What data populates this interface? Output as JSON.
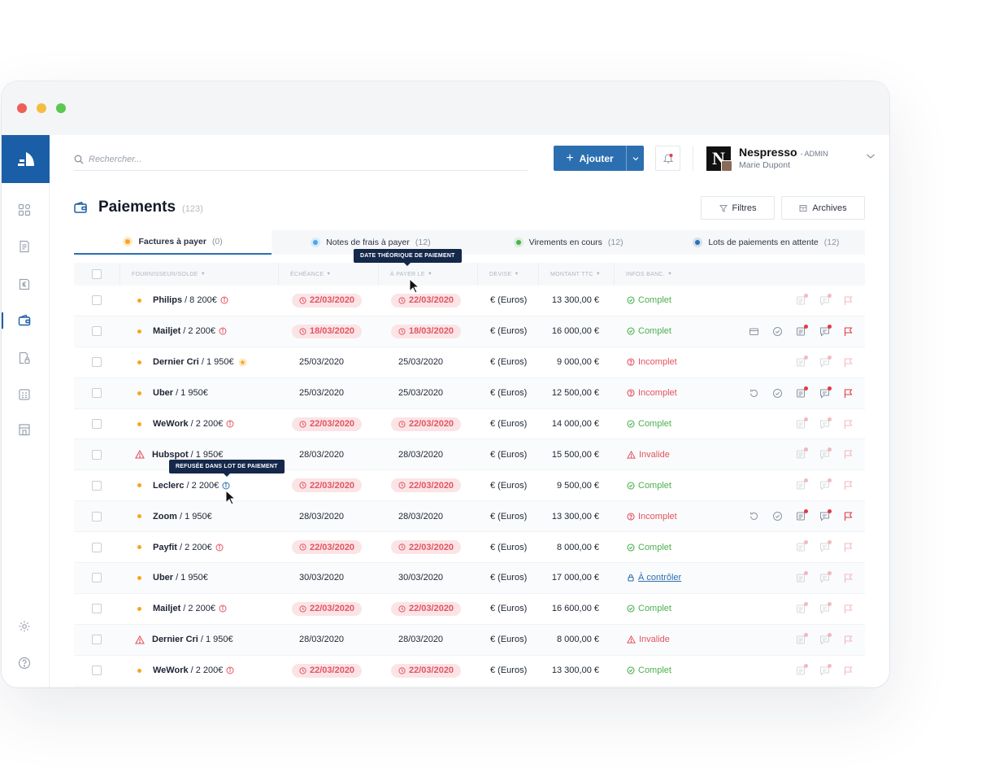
{
  "search": {
    "placeholder": "Rechercher..."
  },
  "header": {
    "add_label": "Ajouter",
    "company": "Nespresso",
    "company_logo_letter": "N",
    "role": "- ADMIN",
    "user": "Marie Dupont"
  },
  "page": {
    "title": "Paiements",
    "count": "(123)",
    "filters_label": "Filtres",
    "archives_label": "Archives"
  },
  "tabs": [
    {
      "label": "Factures à payer",
      "count": "(0)",
      "color": "#f5a623"
    },
    {
      "label": "Notes de frais à payer",
      "count": "(12)",
      "color": "#4aa8e8"
    },
    {
      "label": "Virements en cours",
      "count": "(12)",
      "color": "#4caf50"
    },
    {
      "label": "Lots de paiements en attente",
      "count": "(12)",
      "color": "#2c6fb1"
    }
  ],
  "columns": {
    "supplier": "FOURNISSEUR/SOLDE",
    "due": "ÉCHÉANCE",
    "pay_on": "À PAYER LE",
    "currency": "DEVISE",
    "amount": "MONTANT TTC",
    "bank": "INFOS BANC."
  },
  "tooltips": {
    "pay_date": "DATE THÉORIQUE DE PAIEMENT",
    "refused": "REFUSÉE DANS LOT DE PAIEMENT"
  },
  "rows": [
    {
      "name": "Philips",
      "balance": "/ 8 200€",
      "due": "22/03/2020",
      "pay": "22/03/2020",
      "currency": "€ (Euros)",
      "amount": "13 300,00 €",
      "status": "Complet"
    },
    {
      "name": "Mailjet",
      "balance": "/ 2 200€",
      "due": "18/03/2020",
      "pay": "18/03/2020",
      "currency": "€ (Euros)",
      "amount": "16 000,00 €",
      "status": "Complet"
    },
    {
      "name": "Dernier Cri",
      "balance": "/ 1 950€",
      "due": "25/03/2020",
      "pay": "25/03/2020",
      "currency": "€ (Euros)",
      "amount": "9 000,00 €",
      "status": "Incomplet"
    },
    {
      "name": "Uber",
      "balance": "/ 1 950€",
      "due": "25/03/2020",
      "pay": "25/03/2020",
      "currency": "€ (Euros)",
      "amount": "12 500,00 €",
      "status": "Incomplet"
    },
    {
      "name": "WeWork",
      "balance": "/ 2 200€",
      "due": "22/03/2020",
      "pay": "22/03/2020",
      "currency": "€ (Euros)",
      "amount": "14 000,00 €",
      "status": "Complet"
    },
    {
      "name": "Hubspot",
      "balance": "/ 1 950€",
      "due": "28/03/2020",
      "pay": "28/03/2020",
      "currency": "€ (Euros)",
      "amount": "15 500,00 €",
      "status": "Invalide"
    },
    {
      "name": "Leclerc",
      "balance": "/ 2 200€",
      "due": "22/03/2020",
      "pay": "22/03/2020",
      "currency": "€ (Euros)",
      "amount": "9 500,00 €",
      "status": "Complet"
    },
    {
      "name": "Zoom",
      "balance": "/ 1 950€",
      "due": "28/03/2020",
      "pay": "28/03/2020",
      "currency": "€ (Euros)",
      "amount": "13 300,00 €",
      "status": "Incomplet"
    },
    {
      "name": "Payfit",
      "balance": "/ 2 200€",
      "due": "22/03/2020",
      "pay": "22/03/2020",
      "currency": "€ (Euros)",
      "amount": "8 000,00 €",
      "status": "Complet"
    },
    {
      "name": "Uber",
      "balance": "/ 1 950€",
      "due": "30/03/2020",
      "pay": "30/03/2020",
      "currency": "€ (Euros)",
      "amount": "17 000,00 €",
      "status": "À contrôler"
    },
    {
      "name": "Mailjet",
      "balance": "/ 2 200€",
      "due": "22/03/2020",
      "pay": "22/03/2020",
      "currency": "€ (Euros)",
      "amount": "16 600,00 €",
      "status": "Complet"
    },
    {
      "name": "Dernier Cri",
      "balance": "/ 1 950€",
      "due": "28/03/2020",
      "pay": "28/03/2020",
      "currency": "€ (Euros)",
      "amount": "8 000,00 €",
      "status": "Invalide"
    },
    {
      "name": "WeWork",
      "balance": "/ 2 200€",
      "due": "22/03/2020",
      "pay": "22/03/2020",
      "currency": "€ (Euros)",
      "amount": "13 300,00 €",
      "status": "Complet"
    }
  ],
  "row_flags": [
    {
      "overdue": true,
      "marker": "dot",
      "note": "info-icon",
      "actions": "faint"
    },
    {
      "overdue": true,
      "marker": "dot",
      "note": "info-icon",
      "actions": "full"
    },
    {
      "overdue": false,
      "marker": "dot",
      "note": "star-icon",
      "actions": "faint"
    },
    {
      "overdue": false,
      "marker": "dot",
      "note": "",
      "actions": "full-refresh"
    },
    {
      "overdue": true,
      "marker": "dot",
      "note": "info-icon",
      "actions": "faint"
    },
    {
      "overdue": false,
      "marker": "warning",
      "note": "",
      "actions": "faint"
    },
    {
      "overdue": true,
      "marker": "dot",
      "note": "info-blue-icon",
      "actions": "faint"
    },
    {
      "overdue": false,
      "marker": "dot",
      "note": "",
      "actions": "full-refresh"
    },
    {
      "overdue": true,
      "marker": "dot",
      "note": "info-icon",
      "actions": "faint"
    },
    {
      "overdue": false,
      "marker": "dot",
      "note": "",
      "actions": "faint"
    },
    {
      "overdue": true,
      "marker": "dot",
      "note": "info-icon",
      "actions": "faint"
    },
    {
      "overdue": false,
      "marker": "warning",
      "note": "",
      "actions": "faint"
    },
    {
      "overdue": true,
      "marker": "dot",
      "note": "info-icon",
      "actions": "faint"
    }
  ],
  "colors": {
    "brand": "#1b5ea8",
    "accent": "#2c6fb1",
    "danger": "#e25562",
    "success": "#4caf50",
    "warning": "#f5a623",
    "tooltip": "#14284a"
  }
}
